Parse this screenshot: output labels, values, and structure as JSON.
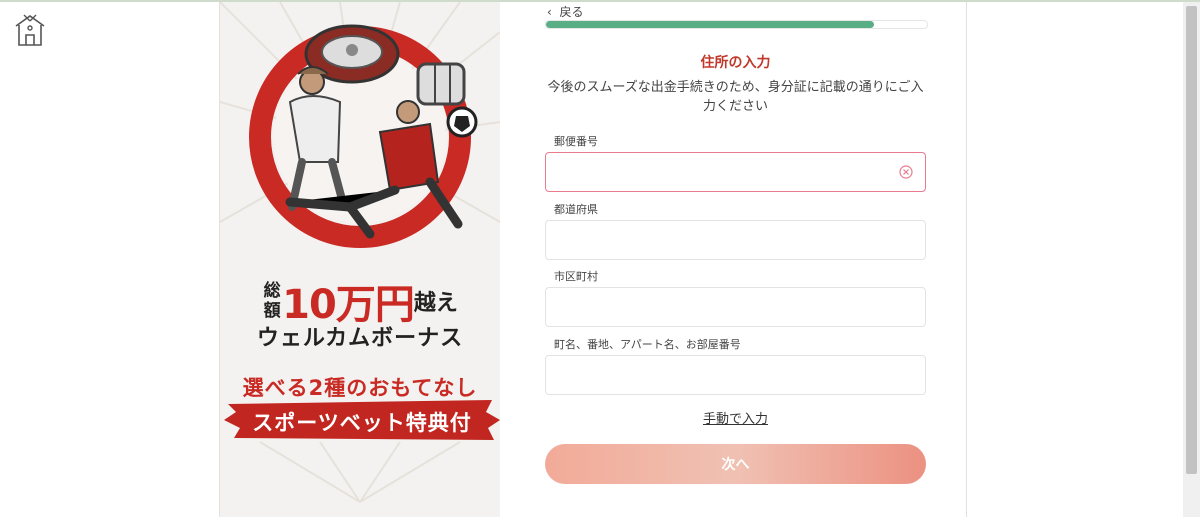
{
  "form": {
    "back_label": "戻る",
    "progress_fraction": 0.86,
    "title": "住所の入力",
    "description": "今後のスムーズな出金手続きのため、身分証に記載の通りにご入力ください",
    "fields": [
      {
        "label": "郵便番号",
        "value": ""
      },
      {
        "label": "都道府県",
        "value": ""
      },
      {
        "label": "市区町村",
        "value": ""
      },
      {
        "label": "町名、番地、アパート名、お部屋番号",
        "value": ""
      }
    ],
    "manual_link": "手動で入力",
    "next_button": "次へ"
  },
  "banner": {
    "total_vertical": "総額",
    "amount": "10万円",
    "koe": "越え",
    "welcome": "ウェルカムボーナス",
    "choose": "選べる2種のおもてなし",
    "sports": "スポーツベット特典付"
  },
  "colors": {
    "accent_red": "#c92a24",
    "progress_green": "#5aae86",
    "button_gradient": "#f2aa98"
  },
  "icons": [
    "home-icon",
    "chevron-left-icon",
    "clear-icon"
  ]
}
